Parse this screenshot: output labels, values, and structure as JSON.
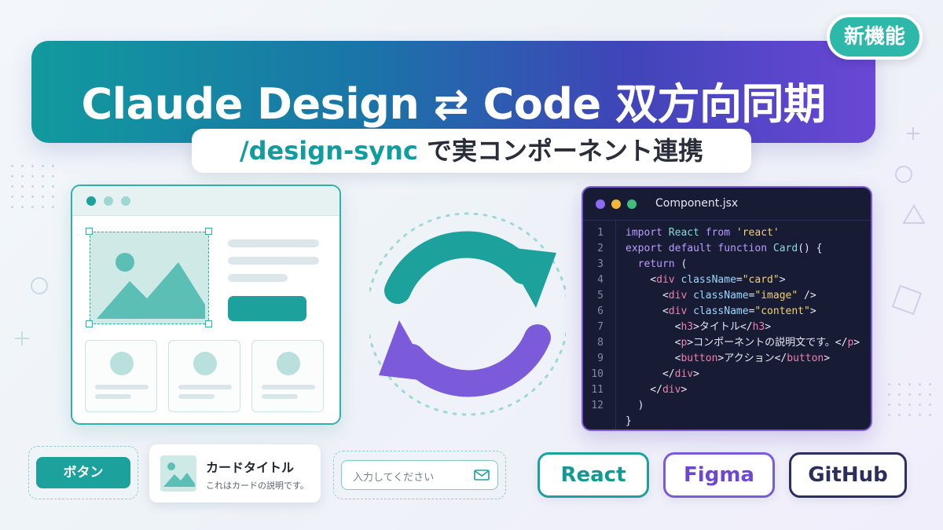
{
  "banner": {
    "title": "Claude Design ⇄ Code 双方向同期",
    "badge": "新機能",
    "subtitle_command": "/design-sync",
    "subtitle_rest": " で実コンポーネント連携"
  },
  "editor": {
    "filename": "Component.jsx",
    "lines": [
      {
        "n": "1",
        "code": "import React from 'react'"
      },
      {
        "n": "2",
        "code": "export default function Card() {"
      },
      {
        "n": "3",
        "code": "  return ("
      },
      {
        "n": "4",
        "code": "    <div className=\"card\">"
      },
      {
        "n": "5",
        "code": "      <div className=\"image\" />"
      },
      {
        "n": "6",
        "code": "      <div className=\"content\">"
      },
      {
        "n": "7",
        "code": "        <h3>タイトル</h3>"
      },
      {
        "n": "8",
        "code": "        <p>コンポーネントの説明文です。</p>"
      },
      {
        "n": "9",
        "code": "        <button>アクション</button>"
      },
      {
        "n": "10",
        "code": "      </div>"
      },
      {
        "n": "11",
        "code": "    </div>"
      },
      {
        "n": "12",
        "code": "  )"
      },
      {
        "n": "",
        "code": "}"
      }
    ]
  },
  "samples": {
    "button_label": "ボタン",
    "card_title": "カードタイトル",
    "card_desc": "これはカードの説明です。",
    "input_placeholder": "入力してください"
  },
  "tech": {
    "react": "React",
    "figma": "Figma",
    "github": "GitHub"
  },
  "colors": {
    "teal": "#1ca19c",
    "purple": "#7b5bd9",
    "navy": "#2a2f5e",
    "editor_bg": "#181b34"
  },
  "icons": [
    "image-icon",
    "mail-icon",
    "sync-icon",
    "window-dots-icon"
  ]
}
